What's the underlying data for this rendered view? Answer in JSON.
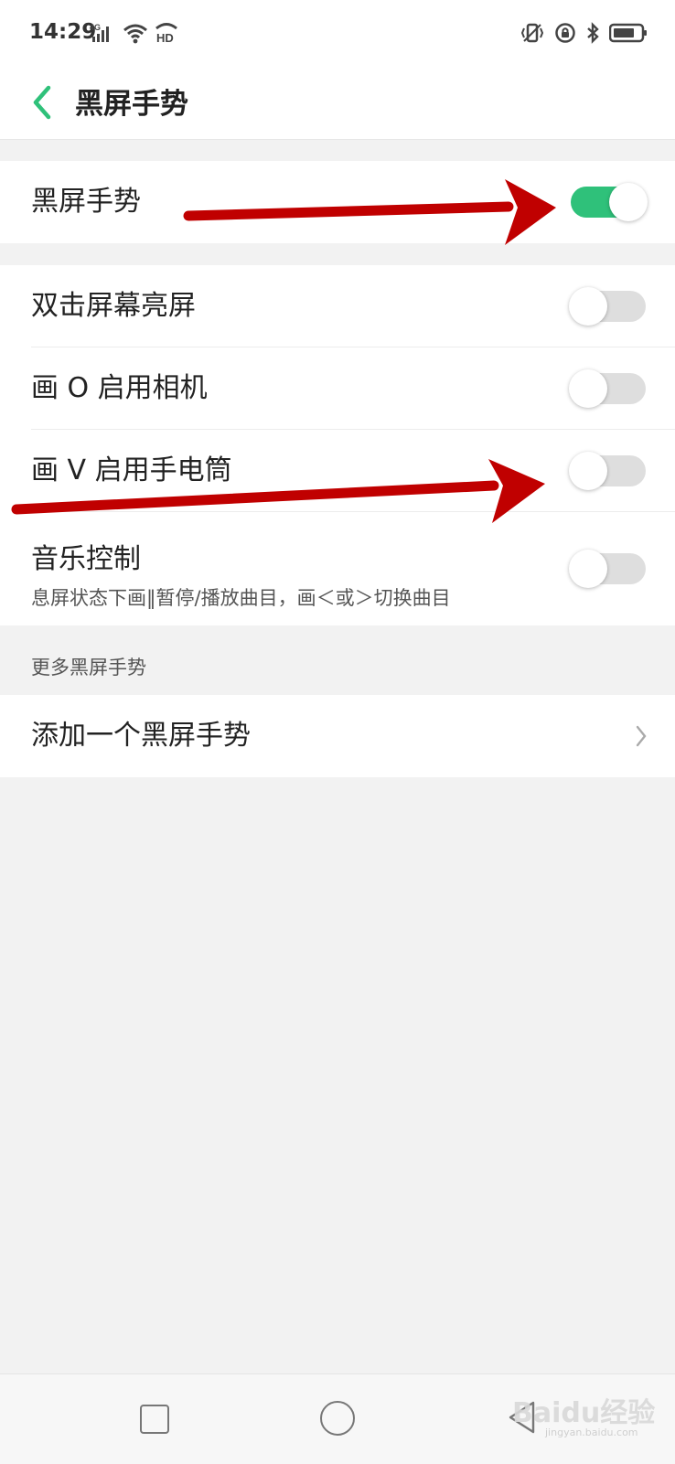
{
  "status_bar": {
    "time": "14:29",
    "network_label": "4G",
    "hd_label": "HD",
    "icons": [
      "signal-icon",
      "wifi-icon",
      "hd-call-icon",
      "vibrate-icon",
      "rotation-lock-icon",
      "bluetooth-icon",
      "battery-icon"
    ]
  },
  "header": {
    "title": "黑屏手势",
    "back_icon": "chevron-left-icon"
  },
  "master": {
    "label": "黑屏手势",
    "enabled": true
  },
  "gestures": [
    {
      "label": "双击屏幕亮屏",
      "enabled": false
    },
    {
      "label": "画 O 启用相机",
      "enabled": false
    },
    {
      "label": "画 V 启用手电筒",
      "enabled": false
    },
    {
      "label": "音乐控制",
      "sublabel": "息屏状态下画‖暂停/播放曲目，画＜或＞切换曲目",
      "enabled": false
    }
  ],
  "more": {
    "section_title": "更多黑屏手势",
    "add_label": "添加一个黑屏手势"
  },
  "navbar": {
    "icons": [
      "recent-apps-icon",
      "home-icon",
      "back-icon"
    ]
  },
  "watermark": {
    "brand": "Baidu经验",
    "site": "jingyan.baidu.com"
  },
  "colors": {
    "accent": "#2fc17a",
    "arrow": "#c00000",
    "toggle_off": "#dedede"
  }
}
